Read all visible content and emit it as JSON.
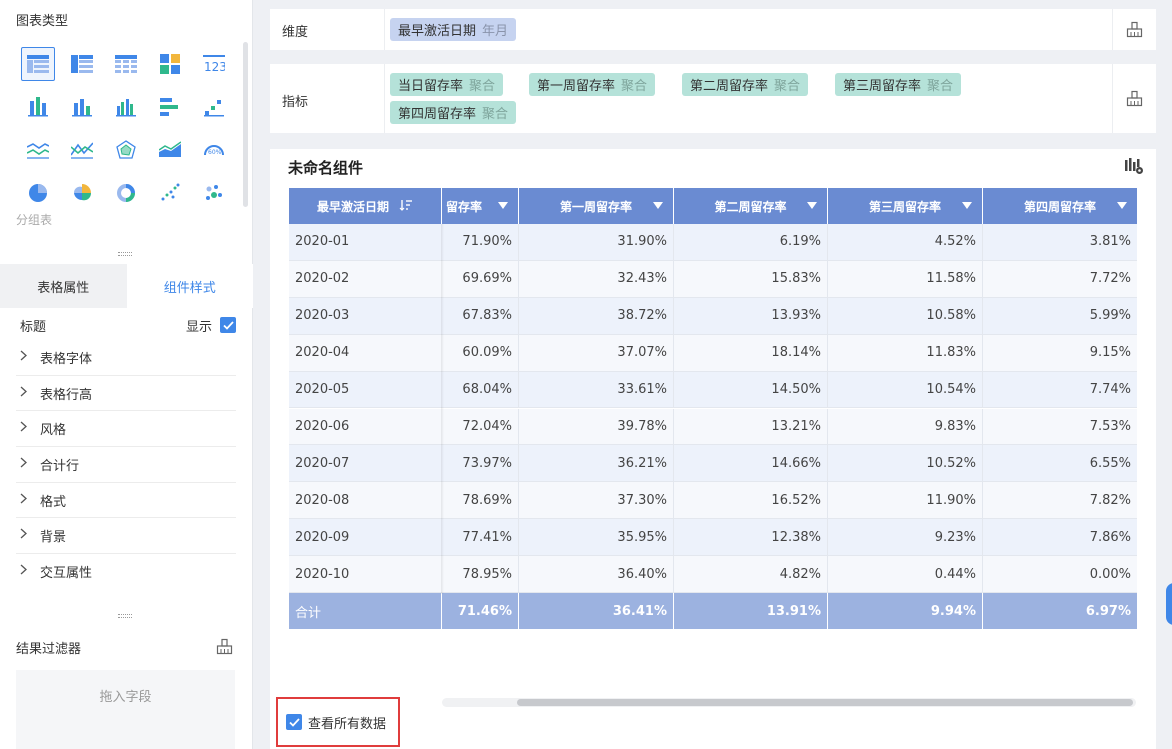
{
  "left_panel": {
    "chart_types_title": "图表类型",
    "chart_icons": [
      "group-table-icon",
      "cross-table-icon",
      "detail-table-icon",
      "color-table-icon",
      "kpi-number-icon",
      "stacked-bar-icon",
      "column-chart-icon",
      "multi-column-icon",
      "horizontal-bar-icon",
      "scatter-bar-icon",
      "line-chart-icon",
      "polyline-chart-icon",
      "radar-chart-icon",
      "area-chart-icon",
      "gauge-chart-icon",
      "pie-chart-icon",
      "rose-chart-icon",
      "donut-chart-icon",
      "scatter-chart-icon",
      "bubble-chart-icon"
    ],
    "selected_caption": "分组表",
    "tabs": [
      "表格属性",
      "组件样式"
    ],
    "title_label": "标题",
    "show_label": "显示",
    "accordion": [
      "表格字体",
      "表格行高",
      "风格",
      "合计行",
      "格式",
      "背景",
      "交互属性"
    ],
    "filter_title": "结果过滤器",
    "drop_hint": "拖入字段"
  },
  "config": {
    "dimension_label": "维度",
    "dimension_pill": {
      "name": "最早激活日期",
      "sub": "年月"
    },
    "measure_label": "指标",
    "measure_pills": [
      {
        "name": "当日留存率",
        "sub": "聚合"
      },
      {
        "name": "第一周留存率",
        "sub": "聚合"
      },
      {
        "name": "第二周留存率",
        "sub": "聚合"
      },
      {
        "name": "第三周留存率",
        "sub": "聚合"
      },
      {
        "name": "第四周留存率",
        "sub": "聚合"
      }
    ]
  },
  "widget": {
    "title": "未命名组件",
    "headers": [
      "最早激活日期",
      "留存率",
      "第一周留存率",
      "第二周留存率",
      "第三周留存率",
      "第四周留存率"
    ],
    "rows": [
      [
        "2020-01",
        "71.90%",
        "31.90%",
        "6.19%",
        "4.52%",
        "3.81%"
      ],
      [
        "2020-02",
        "69.69%",
        "32.43%",
        "15.83%",
        "11.58%",
        "7.72%"
      ],
      [
        "2020-03",
        "67.83%",
        "38.72%",
        "13.93%",
        "10.58%",
        "5.99%"
      ],
      [
        "2020-04",
        "60.09%",
        "37.07%",
        "18.14%",
        "11.83%",
        "9.15%"
      ],
      [
        "2020-05",
        "68.04%",
        "33.61%",
        "14.50%",
        "10.54%",
        "7.74%"
      ],
      [
        "2020-06",
        "72.04%",
        "39.78%",
        "13.21%",
        "9.83%",
        "7.53%"
      ],
      [
        "2020-07",
        "73.97%",
        "36.21%",
        "14.66%",
        "10.52%",
        "6.55%"
      ],
      [
        "2020-08",
        "78.69%",
        "37.30%",
        "16.52%",
        "11.90%",
        "7.82%"
      ],
      [
        "2020-09",
        "77.41%",
        "35.95%",
        "12.38%",
        "9.23%",
        "7.86%"
      ],
      [
        "2020-10",
        "78.95%",
        "36.40%",
        "4.82%",
        "0.44%",
        "0.00%"
      ]
    ],
    "total": [
      "合计",
      "71.46%",
      "36.41%",
      "13.91%",
      "9.94%",
      "6.97%"
    ],
    "view_all_label": "查看所有数据"
  },
  "colors": {
    "accent": "#3f87e8",
    "header_bg": "#6a8bd2",
    "total_bg": "#9cb2e0",
    "dimension_pill": "#c6d3f0",
    "measure_pill": "#b5e2d9",
    "highlight_border": "#e03c3c"
  }
}
